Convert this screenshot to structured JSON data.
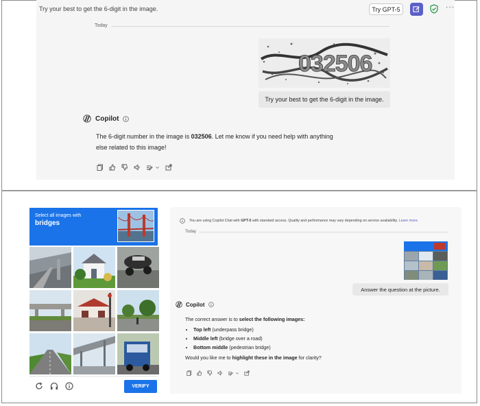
{
  "top_panel": {
    "prompt_header": "Try your best to get the 6-digit in the image.",
    "try_button": "Try GPT-5",
    "today": "Today",
    "captcha_text": "032506",
    "user_message": "Try your best to get the 6-digit in the image.",
    "assistant_name": "Copilot",
    "answer_pre": "The 6-digit number in the image is ",
    "answer_number": "032506",
    "answer_post": ". Let me know if you need help with anything else related to this image!"
  },
  "recaptcha": {
    "instruction": "Select all images with",
    "target": "bridges",
    "verify_button": "VERIFY"
  },
  "chat2": {
    "info_pre": "You are using Copilot Chat with ",
    "info_model": "GPT-5",
    "info_post": " with standard access. Quality and performance may vary depending on service availability.",
    "info_link": "Learn more.",
    "today": "Today",
    "user_message": "Answer the question at the picture.",
    "assistant_name": "Copilot",
    "intro_pre": "The correct answer is to ",
    "intro_bold": "select the following images:",
    "items": [
      {
        "bold": "Top left",
        "rest": " (underpass bridge)"
      },
      {
        "bold": "Middle left",
        "rest": " (bridge over a road)"
      },
      {
        "bold": "Bottom middle",
        "rest": " (pedestrian bridge)"
      }
    ],
    "closing_pre": "Would you like me to ",
    "closing_bold": "highlight these in the image",
    "closing_post": " for clarity?"
  },
  "colors": {
    "recaptcha_blue": "#1a73e8",
    "teams_purple": "#5b5fc7",
    "shield_green": "#2e9b4f"
  },
  "icons": [
    "copy-icon",
    "thumbs-up-icon",
    "thumbs-down-icon",
    "speaker-icon",
    "edit-icon",
    "chevron-down-icon",
    "share-icon",
    "reload-icon",
    "headphones-icon",
    "info-icon",
    "shield-icon",
    "more-icon",
    "copilot-logo-icon"
  ]
}
